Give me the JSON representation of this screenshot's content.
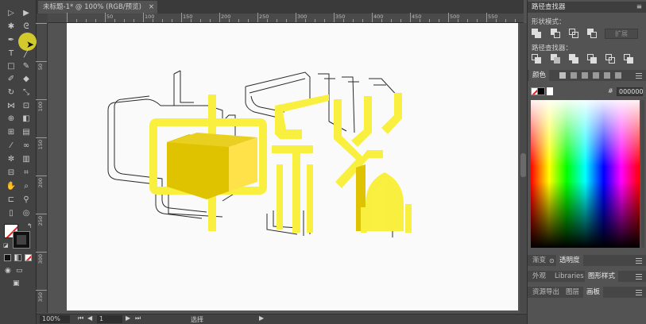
{
  "document": {
    "tab_title": "未标题-1* @ 100% (RGB/预览)",
    "close_glyph": "×"
  },
  "rulers": {
    "top_labels": [
      "50",
      "100",
      "150",
      "200",
      "250",
      "300",
      "350",
      "400",
      "450",
      "500",
      "550"
    ],
    "left_labels": [
      "50",
      "100",
      "150",
      "200",
      "250",
      "300",
      "350"
    ]
  },
  "status": {
    "zoom": "100%",
    "artboard_number": "1",
    "tool_name": "选择"
  },
  "pathfinder": {
    "title": "路径查找器",
    "shape_modes_label": "形状模式：",
    "pathfinders_label": "路径查找器：",
    "expand_label": "扩展"
  },
  "color": {
    "tabs": [
      "颜色"
    ],
    "hex_value": "000000",
    "hex_prefix": "#"
  },
  "lower_panels": {
    "row1_tabs": [
      "渐变",
      "透明度"
    ],
    "row2_tabs": [
      "外观",
      "Libraries",
      "图形样式"
    ],
    "row3_tabs": [
      "资源导出",
      "图层",
      "画板"
    ],
    "active_row1": "透明度",
    "active_row2": "图形样式",
    "active_row3": "画板"
  },
  "artwork": {
    "fill_color": "#f9ef3f",
    "shade_color": "#e0c300",
    "stroke_color": "#2a2a2a"
  }
}
